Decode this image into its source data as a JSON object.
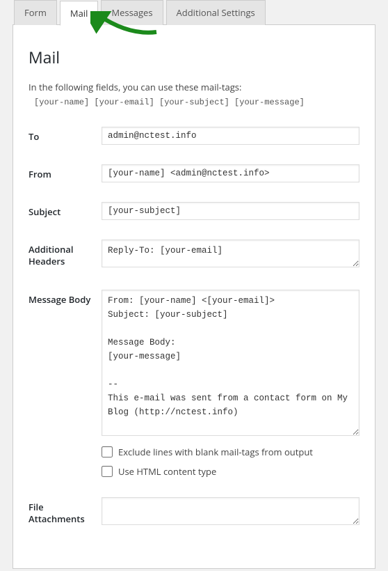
{
  "tabs": {
    "form": "Form",
    "mail": "Mail",
    "messages": "Messages",
    "additional": "Additional Settings"
  },
  "section": {
    "title": "Mail",
    "desc": "In the following fields, you can use these mail-tags:",
    "mailtags": "[your-name] [your-email] [your-subject] [your-message]"
  },
  "labels": {
    "to": "To",
    "from": "From",
    "subject": "Subject",
    "headers": "Additional Headers",
    "body": "Message Body",
    "attachments": "File Attachments",
    "exclude": "Exclude lines with blank mail-tags from output",
    "usehtml": "Use HTML content type"
  },
  "fields": {
    "to": "admin@nctest.info",
    "from": "[your-name] <admin@nctest.info>",
    "subject": "[your-subject]",
    "headers": "Reply-To: [your-email]",
    "body": "From: [your-name] <[your-email]>\nSubject: [your-subject]\n\nMessage Body:\n[your-message]\n\n--\nThis e-mail was sent from a contact form on My Blog (http://nctest.info)",
    "attachments": ""
  }
}
